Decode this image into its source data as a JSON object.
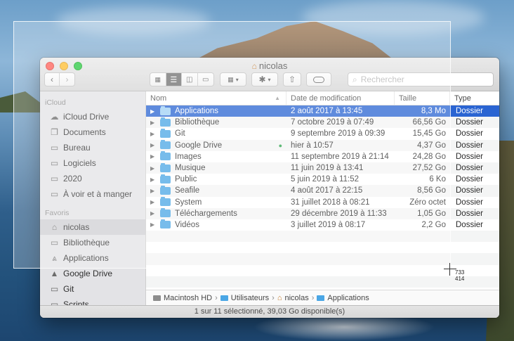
{
  "window": {
    "title": "nicolas",
    "title_icon": "home-icon"
  },
  "toolbar": {
    "back": "‹",
    "forward": "›",
    "search_placeholder": "Rechercher",
    "view_modes": [
      "icon-view",
      "list-view",
      "column-view",
      "gallery-view"
    ],
    "active_view": "list-view"
  },
  "sidebar": {
    "sections": [
      {
        "title": "iCloud",
        "items": [
          {
            "label": "iCloud Drive",
            "icon": "cloud-icon"
          },
          {
            "label": "Documents",
            "icon": "documents-icon"
          },
          {
            "label": "Bureau",
            "icon": "desktop-icon"
          },
          {
            "label": "Logiciels",
            "icon": "folder-icon"
          },
          {
            "label": "2020",
            "icon": "folder-icon"
          },
          {
            "label": "À voir et à manger",
            "icon": "folder-icon"
          }
        ]
      },
      {
        "title": "Favoris",
        "items": [
          {
            "label": "nicolas",
            "icon": "home-icon",
            "selected": true
          },
          {
            "label": "Bibliothèque",
            "icon": "folder-icon"
          },
          {
            "label": "Applications",
            "icon": "applications-icon"
          },
          {
            "label": "Google Drive",
            "icon": "google-drive-icon"
          },
          {
            "label": "Git",
            "icon": "folder-icon"
          },
          {
            "label": "Scripts",
            "icon": "folder-icon"
          }
        ]
      }
    ]
  },
  "table": {
    "columns": {
      "name": "Nom",
      "date": "Date de modification",
      "size": "Taille",
      "kind": "Type"
    },
    "rows": [
      {
        "name": "Applications",
        "date": "2 août 2017 à 13:45",
        "size": "8,3 Mo",
        "kind": "Dossier",
        "selected": true
      },
      {
        "name": "Bibliothèque",
        "date": "7 octobre 2019 à 07:49",
        "size": "66,56 Go",
        "kind": "Dossier"
      },
      {
        "name": "Git",
        "date": "9 septembre 2019 à 09:39",
        "size": "15,45 Go",
        "kind": "Dossier"
      },
      {
        "name": "Google Drive",
        "date": "hier à 10:57",
        "size": "4,37 Go",
        "kind": "Dossier",
        "synced": true
      },
      {
        "name": "Images",
        "date": "11 septembre 2019 à 21:14",
        "size": "24,28 Go",
        "kind": "Dossier"
      },
      {
        "name": "Musique",
        "date": "11 juin 2019 à 13:41",
        "size": "27,52 Go",
        "kind": "Dossier"
      },
      {
        "name": "Public",
        "date": "5 juin 2019 à 11:52",
        "size": "6 Ko",
        "kind": "Dossier"
      },
      {
        "name": "Seafile",
        "date": "4 août 2017 à 22:15",
        "size": "8,56 Go",
        "kind": "Dossier"
      },
      {
        "name": "System",
        "date": "31 juillet 2018 à 08:21",
        "size": "Zéro octet",
        "kind": "Dossier"
      },
      {
        "name": "Téléchargements",
        "date": "29 décembre 2019 à 11:33",
        "size": "1,05 Go",
        "kind": "Dossier"
      },
      {
        "name": "Vidéos",
        "date": "3 juillet 2019 à 08:17",
        "size": "2,2 Go",
        "kind": "Dossier"
      }
    ]
  },
  "pathbar": [
    "Macintosh HD",
    "Utilisateurs",
    "nicolas",
    "Applications"
  ],
  "status": "1 sur 11 sélectionné, 39,03 Go disponible(s)",
  "capture": {
    "x_readout": "733",
    "y_readout": "414"
  },
  "colors": {
    "selection": "#2a64d2",
    "folder": "#4aa6e5"
  }
}
